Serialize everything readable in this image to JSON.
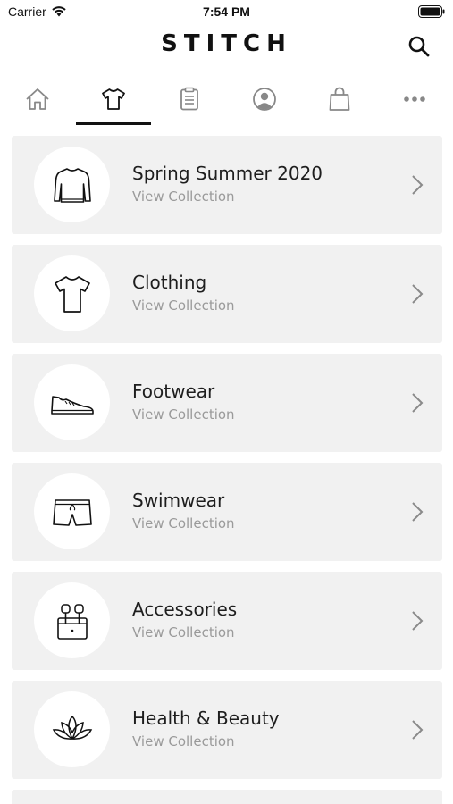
{
  "status_bar": {
    "carrier": "Carrier",
    "time": "7:54 PM"
  },
  "header": {
    "logo": "STITCH",
    "search_icon": "search-icon"
  },
  "tabs": [
    {
      "name": "home",
      "icon": "home-icon",
      "active": false
    },
    {
      "name": "clothing",
      "icon": "tshirt-icon",
      "active": true
    },
    {
      "name": "orders",
      "icon": "clipboard-icon",
      "active": false
    },
    {
      "name": "account",
      "icon": "user-icon",
      "active": false
    },
    {
      "name": "bag",
      "icon": "shopping-bag-icon",
      "active": false
    },
    {
      "name": "more",
      "icon": "more-icon",
      "active": false
    }
  ],
  "collections": [
    {
      "title": "Spring Summer 2020",
      "subtitle": "View Collection",
      "icon": "sweater-icon"
    },
    {
      "title": "Clothing",
      "subtitle": "View Collection",
      "icon": "tshirt-icon"
    },
    {
      "title": "Footwear",
      "subtitle": "View Collection",
      "icon": "sneaker-icon"
    },
    {
      "title": "Swimwear",
      "subtitle": "View Collection",
      "icon": "swim-shorts-icon"
    },
    {
      "title": "Accessories",
      "subtitle": "View Collection",
      "icon": "earbuds-icon"
    },
    {
      "title": "Health & Beauty",
      "subtitle": "View Collection",
      "icon": "lotus-icon"
    }
  ],
  "colors": {
    "card_bg": "#f1f1f1",
    "text": "#1e1e1e",
    "subtext": "#9a9a9a",
    "accent": "#111111"
  }
}
